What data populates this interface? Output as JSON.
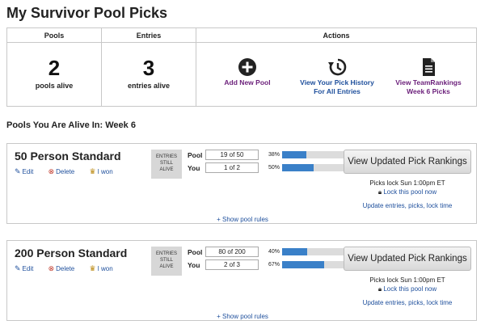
{
  "page_title": "My Survivor Pool Picks",
  "summary": {
    "pools_header": "Pools",
    "entries_header": "Entries",
    "actions_header": "Actions",
    "pools_count": "2",
    "pools_label": "pools alive",
    "entries_count": "3",
    "entries_label": "entries alive",
    "actions": [
      {
        "icon": "plus-circle-icon",
        "line1": "Add New Pool",
        "line2": ""
      },
      {
        "icon": "history-icon",
        "line1": "View Your Pick History",
        "line2": "For All Entries"
      },
      {
        "icon": "document-icon",
        "line1": "View TeamRankings",
        "line2": "Week 6 Picks"
      }
    ]
  },
  "section_title": "Pools You Are Alive In: Week 6",
  "pools": [
    {
      "name": "50 Person Standard",
      "edit": "Edit",
      "delete": "Delete",
      "won": "I won",
      "entries_still_alive": [
        "ENTRIES",
        "STILL",
        "ALIVE"
      ],
      "pool_label": "Pool",
      "pool_value": "19 of 50",
      "pool_pct": "38%",
      "pool_fraction": 0.38,
      "you_label": "You",
      "you_value": "1 of 2",
      "you_pct": "50%",
      "you_fraction": 0.5,
      "rank_button": "View Updated Pick Rankings",
      "lock_time": "Picks lock Sun 1:00pm ET",
      "lock_link": "Lock this pool now",
      "update_link": "Update entries, picks, lock time",
      "rules_link": "Show pool rules"
    },
    {
      "name": "200 Person Standard",
      "edit": "Edit",
      "delete": "Delete",
      "won": "I won",
      "entries_still_alive": [
        "ENTRIES",
        "STILL",
        "ALIVE"
      ],
      "pool_label": "Pool",
      "pool_value": "80 of 200",
      "pool_pct": "40%",
      "pool_fraction": 0.4,
      "you_label": "You",
      "you_value": "2 of 3",
      "you_pct": "67%",
      "you_fraction": 0.67,
      "rank_button": "View Updated Pick Rankings",
      "lock_time": "Picks lock Sun 1:00pm ET",
      "lock_link": "Lock this pool now",
      "update_link": "Update entries, picks, lock time",
      "rules_link": "Show pool rules"
    }
  ],
  "colors": {
    "link_blue": "#1e4f9c",
    "action_purple": "#6b1f7a",
    "bar_fill": "#3a80c8",
    "bar_track": "#dcdcdc"
  }
}
